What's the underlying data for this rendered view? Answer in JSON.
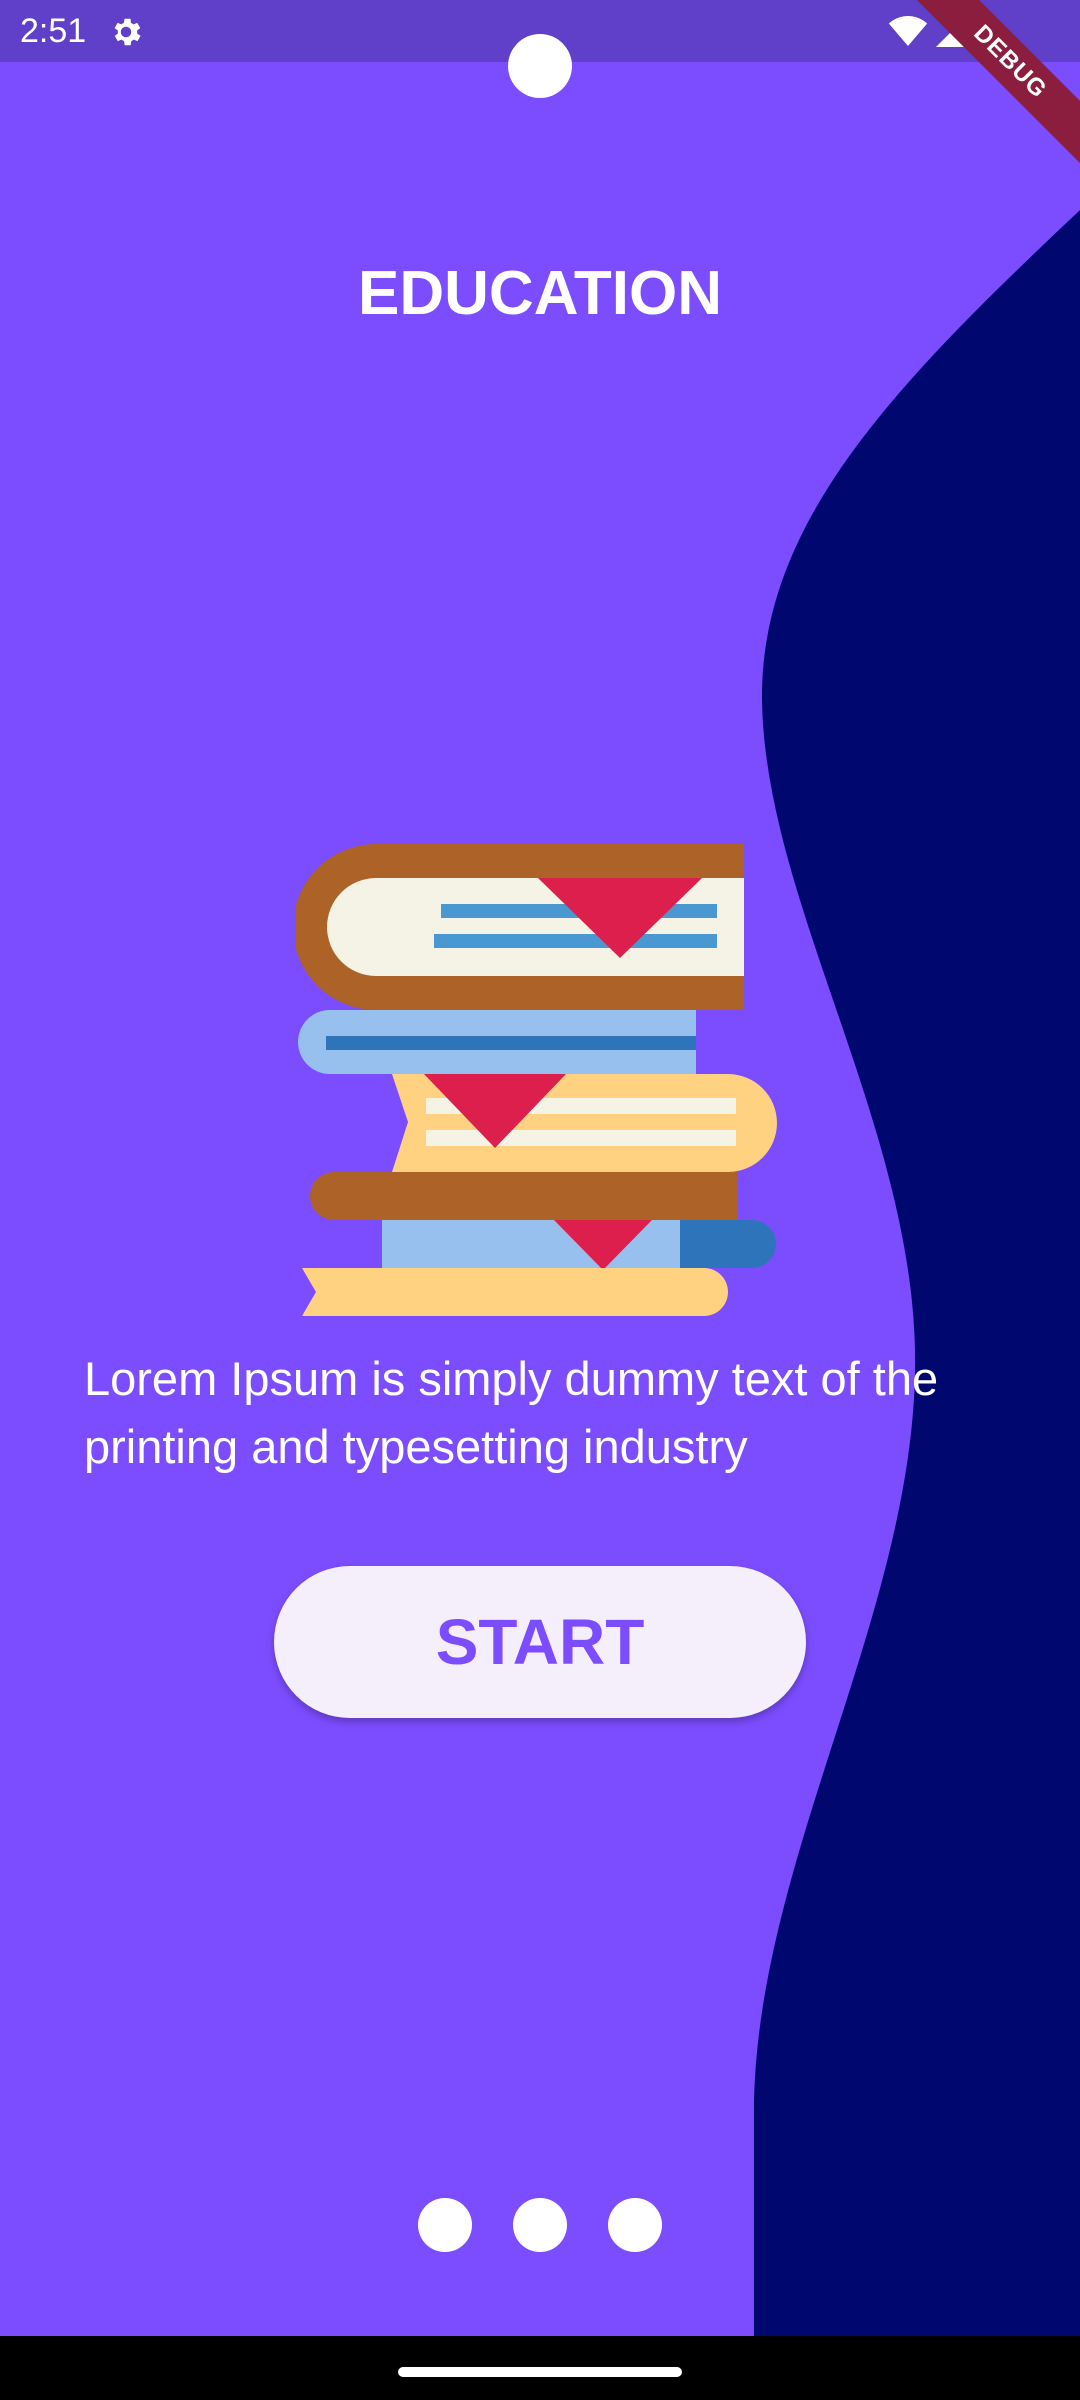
{
  "status_bar": {
    "time": "2:51",
    "settings_icon": "gear-icon",
    "wifi_icon": "wifi-icon",
    "signal_icon": "cell-signal-icon"
  },
  "debug_banner": {
    "label": "DEBUG"
  },
  "onboarding": {
    "title": "EDUCATION",
    "illustration": "books-stack-illustration",
    "description": "Lorem Ipsum is simply dummy text of the printing and typesetting industry",
    "start_label": "START",
    "page_count": 3
  },
  "colors": {
    "background": "#7c4dff",
    "wave": "#00076f",
    "button_bg": "#f4effa",
    "button_text": "#7c4dff",
    "status_bar": "#6040c8"
  }
}
